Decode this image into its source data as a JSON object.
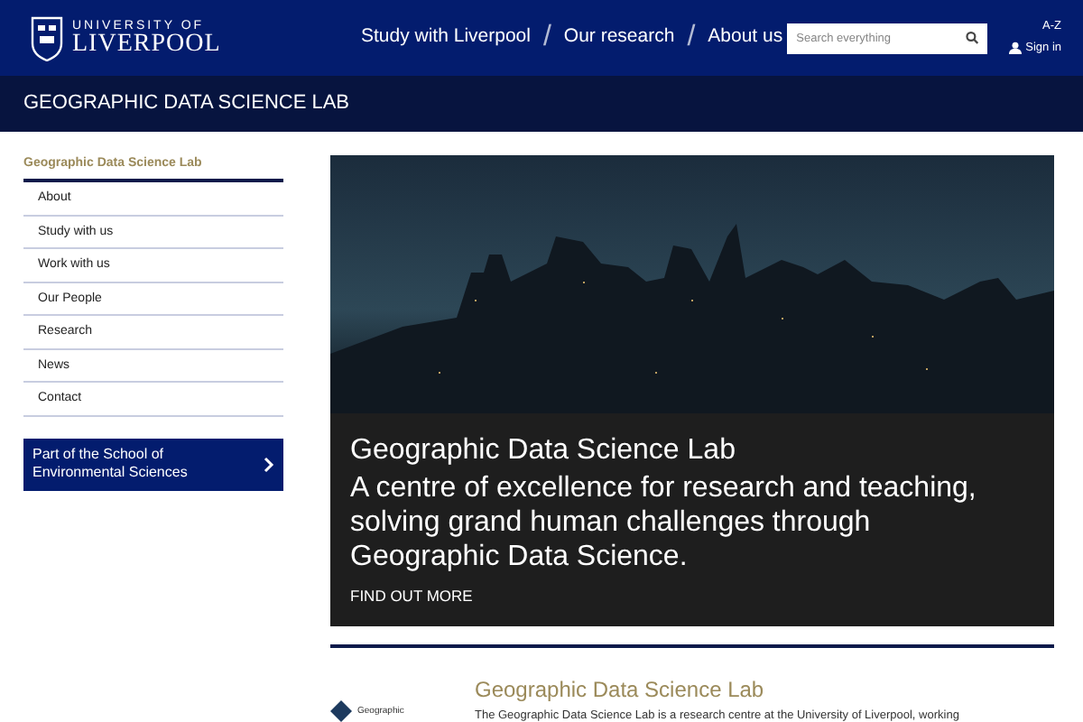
{
  "header": {
    "logo_top": "UNIVERSITY OF",
    "logo_bottom": "LIVERPOOL",
    "nav": [
      {
        "label": "Study with Liverpool"
      },
      {
        "label": "Our research"
      },
      {
        "label": "About us"
      }
    ],
    "nav_separator": "/",
    "search": {
      "placeholder": "Search everything"
    },
    "az": "A-Z",
    "sign_in": "Sign in"
  },
  "section_title": "GEOGRAPHIC DATA SCIENCE LAB",
  "sidebar": {
    "title": "Geographic Data Science Lab",
    "items": [
      {
        "label": "About"
      },
      {
        "label": "Study with us"
      },
      {
        "label": "Work with us"
      },
      {
        "label": "Our People"
      },
      {
        "label": "Research"
      },
      {
        "label": "News"
      },
      {
        "label": "Contact"
      }
    ],
    "school_link": "Part of the School of Environmental Sciences"
  },
  "hero": {
    "title": "Geographic Data Science Lab",
    "subtitle": "A centre of excellence for research and teaching, solving grand human challenges through Geographic Data Science.",
    "cta": "FIND OUT MORE"
  },
  "intro": {
    "logo_text": "Geographic",
    "heading": "Geographic Data Science Lab",
    "text": "The Geographic Data Science Lab is a research centre at the University of Liverpool, working"
  }
}
